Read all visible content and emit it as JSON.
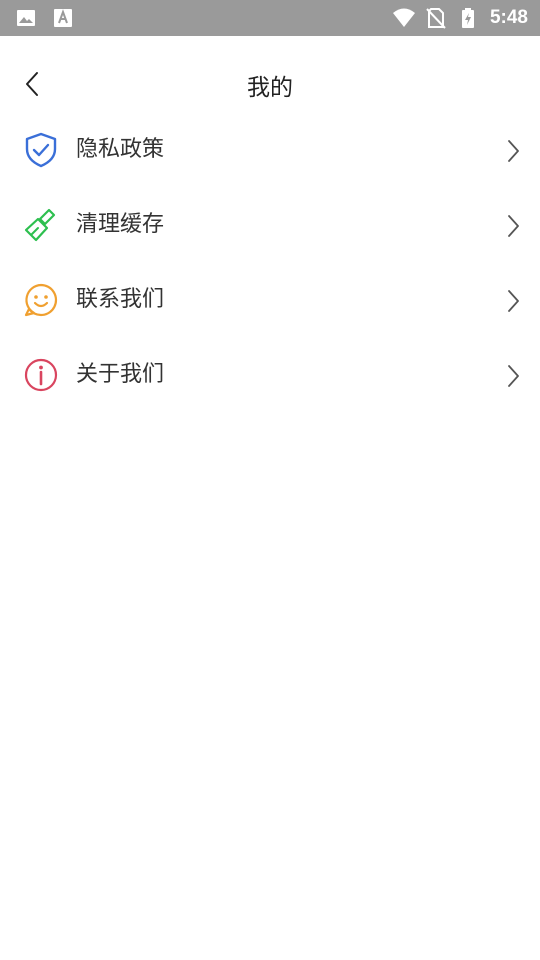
{
  "status_bar": {
    "time": "5:48",
    "icons": [
      "image-icon",
      "font-a-icon",
      "wifi-icon",
      "no-sim-icon",
      "battery-charging-icon"
    ]
  },
  "header": {
    "title": "我的",
    "back_icon": "chevron-left-icon"
  },
  "menu": {
    "items": [
      {
        "label": "隐私政策",
        "icon": "shield-check-icon",
        "color": "#3a6fd8"
      },
      {
        "label": "清理缓存",
        "icon": "broom-icon",
        "color": "#2dbf4f"
      },
      {
        "label": "联系我们",
        "icon": "smiley-chat-icon",
        "color": "#f0a030"
      },
      {
        "label": "关于我们",
        "icon": "info-circle-icon",
        "color": "#d9455f"
      }
    ]
  }
}
